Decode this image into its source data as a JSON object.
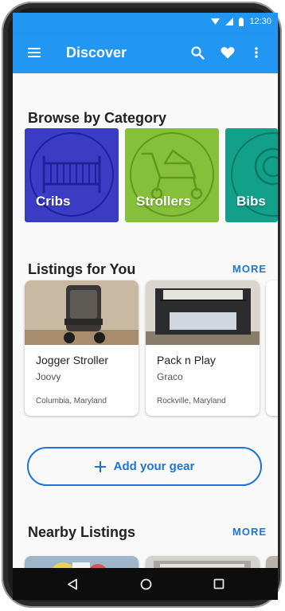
{
  "status_bar": {
    "time": "12:30"
  },
  "app_bar": {
    "title": "Discover"
  },
  "categories": {
    "title": "Browse by Category",
    "items": [
      {
        "label": "Cribs",
        "color": "#3a3dc4"
      },
      {
        "label": "Strollers",
        "color": "#86c03a"
      },
      {
        "label": "Bibs",
        "color": "#12a08a"
      }
    ]
  },
  "listings": {
    "title": "Listings for You",
    "more_label": "MORE",
    "items": [
      {
        "title": "Jogger Stroller",
        "brand": "Joovy",
        "location": "Columbia, Maryland"
      },
      {
        "title": "Pack n Play",
        "brand": "Graco",
        "location": "Rockville, Maryland"
      }
    ]
  },
  "add_gear": {
    "label": "Add your gear"
  },
  "nearby": {
    "title": "Nearby Listings",
    "more_label": "MORE"
  }
}
